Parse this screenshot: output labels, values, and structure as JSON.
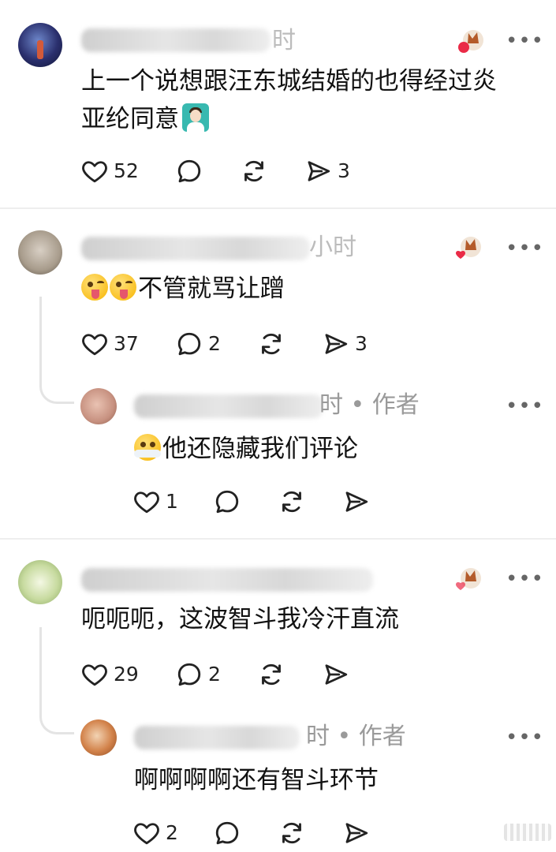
{
  "comments": [
    {
      "time_suffix": "时",
      "text": "上一个说想跟汪东城结婚的也得经过炎",
      "text_line2": "亚纶同意",
      "likes": "52",
      "shares": "3",
      "has_badge": true
    },
    {
      "time_suffix": "小时",
      "text": "不管就骂让蹭",
      "likes": "37",
      "replies": "2",
      "shares": "3",
      "has_badge": true,
      "reply": {
        "time_suffix": "时 • 作者",
        "text": "他还隐藏我们评论",
        "likes": "1"
      }
    },
    {
      "time_suffix": "",
      "text": "呃呃呃，这波智斗我冷汗直流",
      "likes": "29",
      "replies": "2",
      "has_badge": true,
      "reply": {
        "time_suffix": "时 • 作者",
        "text": "啊啊啊啊还有智斗环节",
        "likes": "2"
      }
    }
  ],
  "icons": {
    "like": "heart-outline-icon",
    "comment": "speech-bubble-icon",
    "repost": "repost-arrows-icon",
    "share": "paper-plane-icon",
    "more": "more-dots-icon"
  },
  "more_label": "•••"
}
